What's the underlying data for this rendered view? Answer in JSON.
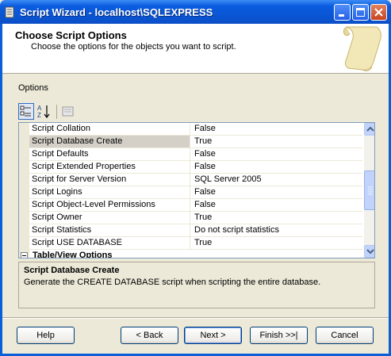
{
  "window": {
    "title": "Script Wizard - localhost\\SQLEXPRESS"
  },
  "header": {
    "title": "Choose Script Options",
    "subtitle": "Choose the options for the objects you want to script."
  },
  "options_label": "Options",
  "toolbar": {
    "icons": [
      "categorized-icon",
      "alphabetical-icon",
      "property-pages-icon"
    ]
  },
  "options": [
    {
      "name": "Script Collation",
      "value": "False"
    },
    {
      "name": "Script Database Create",
      "value": "True",
      "selected": true
    },
    {
      "name": "Script Defaults",
      "value": "False"
    },
    {
      "name": "Script Extended Properties",
      "value": "False"
    },
    {
      "name": "Script for Server Version",
      "value": "SQL Server 2005"
    },
    {
      "name": "Script Logins",
      "value": "False"
    },
    {
      "name": "Script Object-Level Permissions",
      "value": "False"
    },
    {
      "name": "Script Owner",
      "value": "True"
    },
    {
      "name": "Script Statistics",
      "value": "Do not script statistics"
    },
    {
      "name": "Script USE DATABASE",
      "value": "True"
    }
  ],
  "category": {
    "label": "Table/View Options"
  },
  "description": {
    "title": "Script Database Create",
    "text": "Generate the CREATE DATABASE script when scripting the entire database."
  },
  "buttons": {
    "help": "Help",
    "back": "< Back",
    "next": "Next >",
    "finish": "Finish >>|",
    "cancel": "Cancel"
  },
  "colors": {
    "title_bar": "#0B5CE0",
    "selection": "#D4D0C8",
    "dialog_bg": "#ECE9D8"
  }
}
